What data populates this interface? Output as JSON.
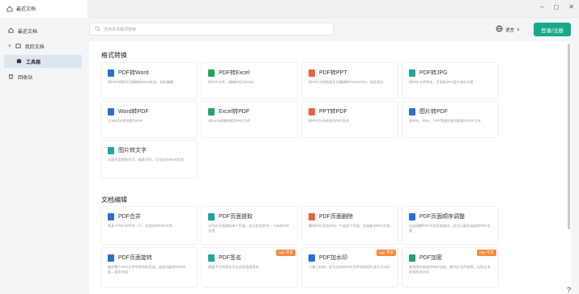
{
  "window": {
    "tab_title": "最近文档",
    "controls": [
      "–",
      "◻",
      "✕"
    ]
  },
  "sidebar": {
    "items": [
      {
        "label": "最近文档",
        "icon": "home-icon"
      },
      {
        "label": "我的文档",
        "icon": "folder-icon"
      },
      {
        "label": "工具箱",
        "icon": "toolbox-icon"
      },
      {
        "label": "回收站",
        "icon": "trash-icon"
      }
    ]
  },
  "topbar": {
    "search_placeholder": "支持多关键词搜索",
    "lang_label": "语言",
    "login_label": "登录/注册"
  },
  "sections": [
    {
      "title": "格式转换"
    },
    {
      "title": "文档编辑"
    }
  ],
  "cards": [
    {
      "title": "PDF转Word",
      "desc": "将PDF转换为可编辑的Word文档，轻松编辑",
      "color": "#2b6fd6",
      "badge": ""
    },
    {
      "title": "PDF转Excel",
      "desc": "把PDF文件，精确转化为Excel",
      "color": "#21a366",
      "badge": ""
    },
    {
      "title": "PDF转PPT",
      "desc": "把PDF文档转换为可编辑的PowerPoint，轻松演示",
      "color": "#e8623a",
      "badge": ""
    },
    {
      "title": "PDF转JPG",
      "desc": "把PDF文件转化，页面转JPG图片保存方便",
      "color": "#1fa5a0",
      "badge": ""
    },
    {
      "title": "Word转PDF",
      "desc": "让Word文件转换为PDF",
      "color": "#2b6fd6",
      "badge": ""
    },
    {
      "title": "Excel转PDF",
      "desc": "将Excel表格转换为PDF文件",
      "color": "#21a366",
      "badge": ""
    },
    {
      "title": "PPT转PDF",
      "desc": "把PPT文件转换为PDF文件",
      "color": "#e8623a",
      "badge": ""
    },
    {
      "title": "图片转PDF",
      "desc": "将JPG、PNG、TIFF等图片格式转换为PDF文件",
      "color": "#2b6fd6",
      "badge": ""
    },
    {
      "title": "图片转文字",
      "desc": "从图片里提取文字，精准识别，可导出为Word文档",
      "color": "#1fa5a0",
      "badge": ""
    },
    {
      "title": "PDF合并",
      "desc": "将多个PDF合并为一个，在线合并PDF文件",
      "color": "#2b6fd6",
      "badge": ""
    },
    {
      "title": "PDF页面提取",
      "desc": "从PDF文档提取单个页面，拆分后合并为一个新的PDF文档",
      "color": "#1fa5a0",
      "badge": ""
    },
    {
      "title": "PDF页面删除",
      "desc": "删除PDF文档中的一个或多个页面，生成新的PDF文档",
      "color": "#e8623a",
      "badge": ""
    },
    {
      "title": "PDF页面顺序调整",
      "desc": "自由调整PDF中的页面顺序，还可以删除或旋转PDF页面",
      "color": "#2b6fd6",
      "badge": ""
    },
    {
      "title": "PDF页面旋转",
      "desc": "旋转整个PDF文件中的所有页面，或定向旋转PDF页面，轻松完成",
      "color": "#2b6fd6",
      "badge": ""
    },
    {
      "title": "PDF签名",
      "desc": "需要手写的签名可在这里直接签名",
      "color": "#1fa5a0",
      "badge": "App 专享"
    },
    {
      "title": "PDF加水印",
      "desc": "只需几秒钟，即可在你的PDF文件添加图片或文字水印",
      "color": "#2b6fd6",
      "badge": "App 专享"
    },
    {
      "title": "PDF加密",
      "desc": "使用密码来保护PDF文档，使PDF文件加密，以防止未经授权的访问",
      "color": "#21a366",
      "badge": "App 专享"
    }
  ],
  "help_label": "?"
}
